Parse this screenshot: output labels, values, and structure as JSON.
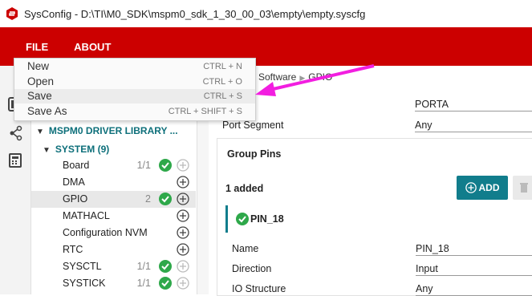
{
  "window": {
    "title": "SysConfig - D:\\TI\\M0_SDK\\mspm0_sdk_1_30_00_03\\empty\\empty.syscfg"
  },
  "menubar": {
    "file": "FILE",
    "about": "ABOUT"
  },
  "file_menu": {
    "items": [
      {
        "label": "New",
        "shortcut": "CTRL + N"
      },
      {
        "label": "Open",
        "shortcut": "CTRL + O"
      },
      {
        "label": "Save",
        "shortcut": "CTRL + S"
      },
      {
        "label": "Save As",
        "shortcut": "CTRL + SHIFT + S"
      }
    ]
  },
  "tree": {
    "library": "MSPM0 DRIVER LIBRARY ...",
    "system": "SYSTEM (9)",
    "modules": [
      {
        "label": "Board",
        "count": "1/1"
      },
      {
        "label": "DMA",
        "count": ""
      },
      {
        "label": "GPIO",
        "count": "2"
      },
      {
        "label": "MATHACL",
        "count": ""
      },
      {
        "label": "Configuration NVM",
        "count": ""
      },
      {
        "label": "RTC",
        "count": ""
      },
      {
        "label": "SYSCTL",
        "count": "1/1"
      },
      {
        "label": "SYSTICK",
        "count": "1/1"
      }
    ]
  },
  "breadcrumb": {
    "part1": "Software",
    "part2": "GPIO"
  },
  "props": {
    "port_value": "PORTA",
    "port_segment_label": "Port Segment",
    "port_segment_value": "Any"
  },
  "group": {
    "title": "Group Pins",
    "added": "1 added",
    "add_label": "ADD",
    "pin_name": "PIN_18",
    "fields": [
      {
        "label": "Name",
        "value": "PIN_18"
      },
      {
        "label": "Direction",
        "value": "Input"
      },
      {
        "label": "IO Structure",
        "value": "Any"
      }
    ]
  },
  "colors": {
    "accent_red": "#cc0000",
    "teal": "#117d8c",
    "ok_green": "#2ea84a",
    "annotation_arrow": "#f21ee0"
  }
}
